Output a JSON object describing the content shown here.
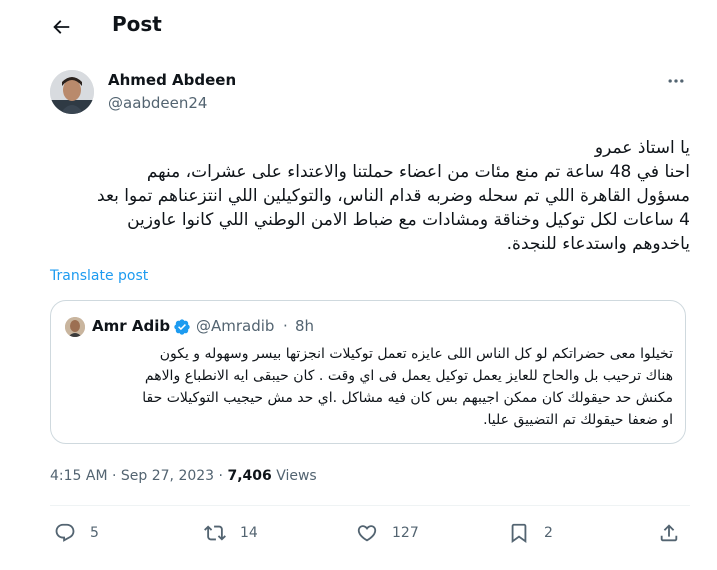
{
  "header": {
    "title": "Post"
  },
  "author": {
    "name": "Ahmed Abdeen",
    "handle": "@aabdeen24"
  },
  "post": {
    "lines": [
      "يا استاذ عمرو",
      "احنا في 48 ساعة تم منع مئات من اعضاء حملتنا والاعتداء على عشرات، منهم",
      "مسؤول القاهرة اللي تم سحله وضربه قدام الناس، والتوكيلين اللي انتزعناهم تموا بعد",
      "4 ساعات لكل توكيل وخناقة ومشادات مع ضباط الامن الوطني اللي كانوا عاوزين",
      "ياخدوهم واستدعاء للنجدة."
    ],
    "translate_label": "Translate post"
  },
  "quote": {
    "name": "Amr Adib",
    "handle": "@Amradib",
    "separator": "·",
    "time": "8h",
    "lines": [
      "تخيلوا معى حضراتكم لو كل الناس اللى عايزه تعمل توكيلات انجزتها بيسر وسهوله و يكون",
      "هناك ترحيب بل والحاح للعايز يعمل توكيل يعمل فى اي وقت . كان حيبقى ايه الانطباع والاهم",
      "مكنش حد حيقولك كان ممكن اجيبهم بس كان فيه مشاكل .اي حد مش حيجيب التوكيلات حقا",
      "او ضعفا حيقولك تم التضييق عليا."
    ]
  },
  "meta": {
    "time": "4:15 AM",
    "dot1": " · ",
    "date": "Sep 27, 2023",
    "dot2": " · ",
    "views_count": "7,406",
    "views_label": " Views"
  },
  "actions": {
    "replies": "5",
    "reposts": "14",
    "likes": "127",
    "bookmarks": "2"
  },
  "colors": {
    "accent": "#1d9bf0",
    "text": "#0f1419",
    "secondary": "#536471",
    "border": "#cfd9de"
  },
  "icons": [
    "back-arrow-icon",
    "more-icon",
    "verified-icon",
    "reply-icon",
    "retweet-icon",
    "like-icon",
    "bookmark-icon",
    "share-icon"
  ]
}
